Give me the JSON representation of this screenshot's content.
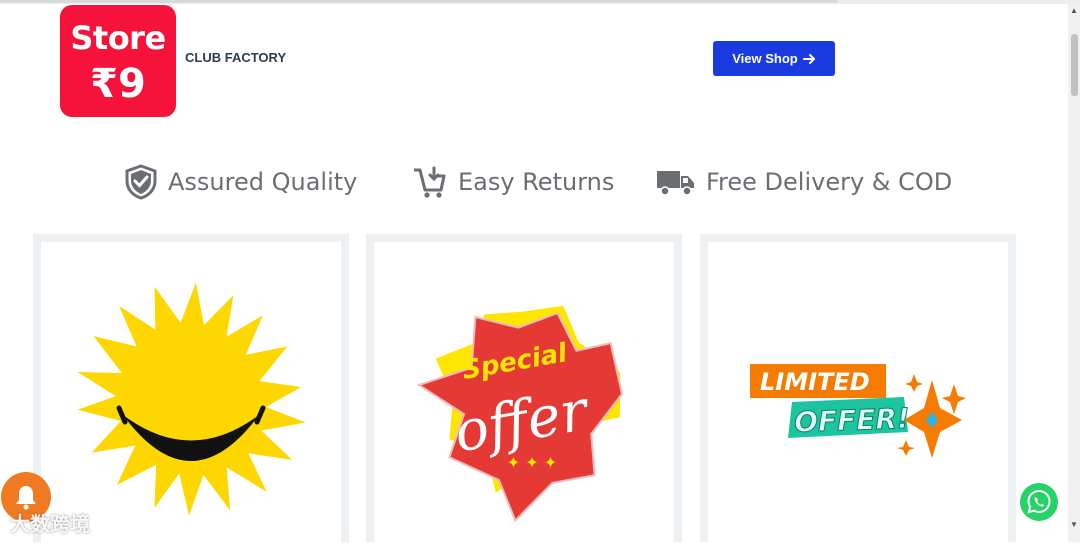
{
  "header": {
    "logo_line1": "Store",
    "logo_line2": "₹9",
    "brand_name": "CLUB FACTORY",
    "view_shop_label": "View Shop",
    "view_shop_icon": "arrow-right-icon"
  },
  "features": [
    {
      "label": "Assured Quality",
      "icon": "shield-check-icon"
    },
    {
      "label": "Easy Returns",
      "icon": "cart-return-icon"
    },
    {
      "label": "Free Delivery & COD",
      "icon": "delivery-truck-icon"
    }
  ],
  "cards": [
    {
      "image": "smiling-sun-icon"
    },
    {
      "image": "special-offer-badge",
      "text_top": "Special",
      "text_main": "offer"
    },
    {
      "image": "limited-offer-sticker",
      "text_top": "LIMITED",
      "text_main": "OFFER!"
    }
  ],
  "floating": {
    "notification_icon": "bell-icon",
    "chat_icon": "whatsapp-icon",
    "watermark": "大数跨境"
  },
  "colors": {
    "logo_red": "#f5123b",
    "button_blue": "#1a3be0",
    "sun_yellow": "#ffd700",
    "badge_red": "#e53935",
    "limited_orange": "#f57c00",
    "offer_teal": "#1cc5a0",
    "bell_orange": "#f07a22",
    "whatsapp_green": "#25d366"
  }
}
